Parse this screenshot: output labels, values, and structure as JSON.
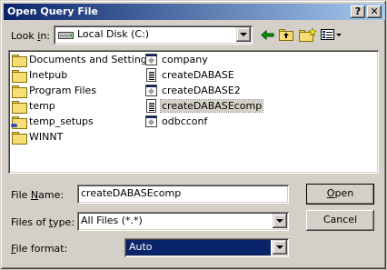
{
  "window": {
    "title": "Open Query File",
    "help_label": "?",
    "close_label": "✕"
  },
  "toolbar": {
    "look_in_label_pre": "Look ",
    "look_in_label_u": "i",
    "look_in_label_post": "n:",
    "look_in_value": "Local Disk (C:)"
  },
  "files": {
    "column1": [
      {
        "name": "Documents and Settings",
        "type": "folder"
      },
      {
        "name": "Inetpub",
        "type": "folder"
      },
      {
        "name": "Program Files",
        "type": "folder"
      },
      {
        "name": "temp",
        "type": "folder"
      },
      {
        "name": "temp_setups",
        "type": "folder-shared"
      },
      {
        "name": "WINNT",
        "type": "folder"
      }
    ],
    "column2": [
      {
        "name": "company",
        "type": "exe"
      },
      {
        "name": "createDABASE",
        "type": "file"
      },
      {
        "name": "createDABASE2",
        "type": "exe"
      },
      {
        "name": "createDABASEcomp",
        "type": "file",
        "selected": true
      },
      {
        "name": "odbcconf",
        "type": "exe"
      }
    ]
  },
  "form": {
    "filename_label_u": "N",
    "filename_label_pre": "File ",
    "filename_label_post": "ame:",
    "filename_value": "createDABASEcomp",
    "filetype_label_pre": "Files of ",
    "filetype_label_u": "t",
    "filetype_label_post": "ype:",
    "filetype_value": "All Files (*.*)",
    "fileformat_label_u": "F",
    "fileformat_label_post": "ile format:",
    "fileformat_value": "Auto"
  },
  "buttons": {
    "open_u": "O",
    "open_post": "pen",
    "cancel": "Cancel"
  },
  "colors": {
    "title_start": "#0a246a",
    "title_end": "#a6caf0",
    "face": "#d4d0c8",
    "highlight": "#0a246a"
  }
}
